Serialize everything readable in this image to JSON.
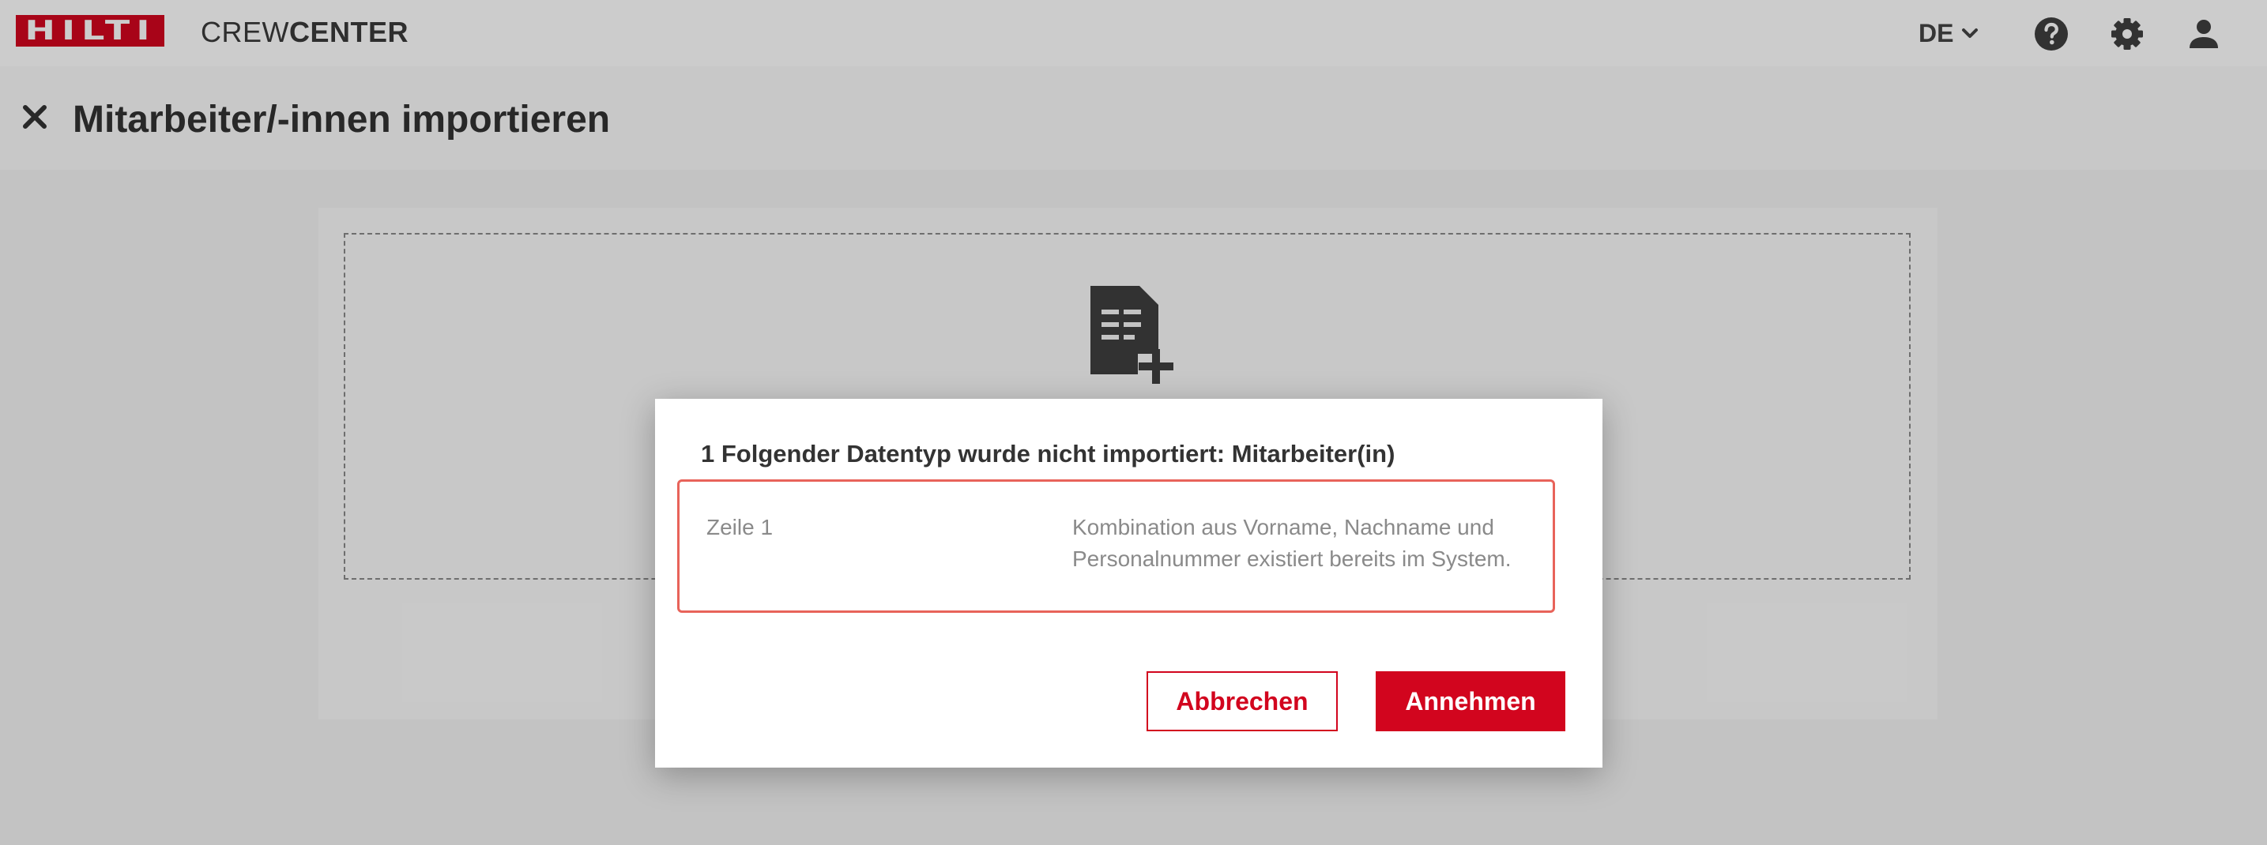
{
  "header": {
    "logo_text": "HILTI",
    "app_name_light": "CREW",
    "app_name_bold": "CENTER",
    "language": "DE",
    "icons": [
      "chevron-down-icon",
      "help-icon",
      "gear-icon",
      "user-icon"
    ],
    "brand_color": "#d2051e"
  },
  "page": {
    "title": "Mitarbeiter/-innen importieren",
    "close_icon": "close-icon",
    "upload_icon": "file-add-icon"
  },
  "dialog": {
    "title": "1 Folgender Datentyp wurde nicht importiert: Mitarbeiter(in)",
    "errors": [
      {
        "row": "Zeile 1",
        "message": "Kombination aus Vorname, Nachname und Personalnummer existiert bereits im System."
      }
    ],
    "cancel_label": "Abbrechen",
    "accept_label": "Annehmen",
    "error_border_color": "#e8635a"
  }
}
